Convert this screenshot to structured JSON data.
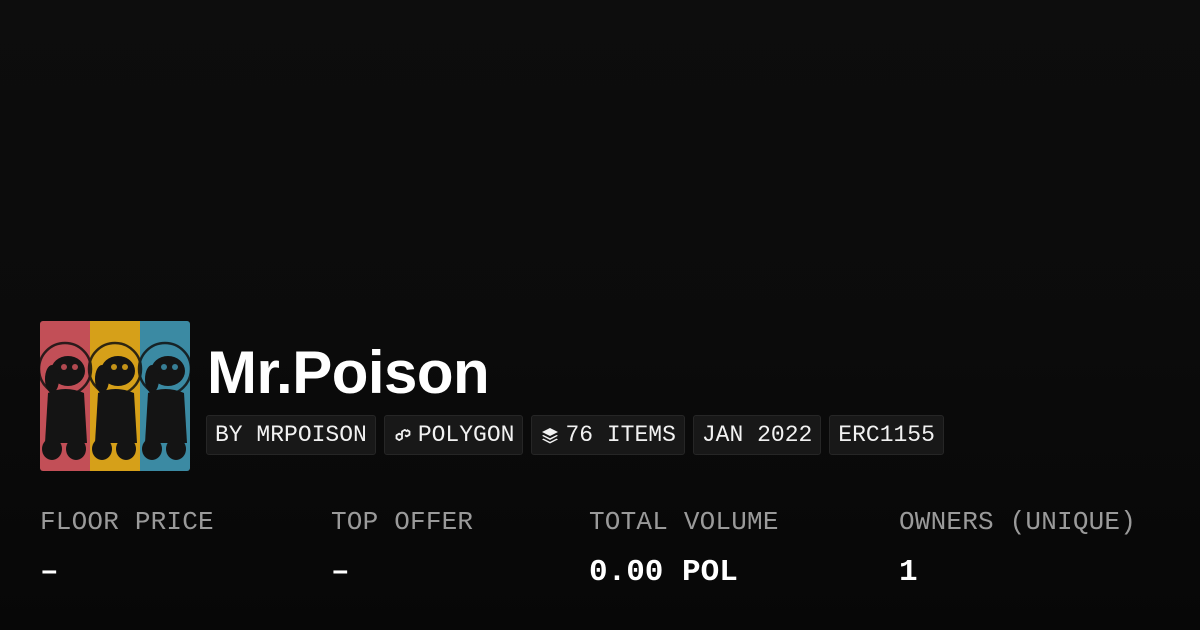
{
  "collection": {
    "name": "Mr.Poison",
    "avatar_alt": "Mr.Poison collection avatar"
  },
  "badges": {
    "creator": "BY MRPOISON",
    "chain": "POLYGON",
    "chain_icon": "polygon-icon",
    "items": "76 ITEMS",
    "items_icon": "layers-icon",
    "date": "JAN 2022",
    "standard": "ERC1155"
  },
  "stats": [
    {
      "label": "FLOOR PRICE",
      "value": "–"
    },
    {
      "label": "TOP OFFER",
      "value": "–"
    },
    {
      "label": "TOTAL VOLUME",
      "value": "0.00 POL"
    },
    {
      "label": "OWNERS (UNIQUE)",
      "value": "1"
    }
  ],
  "colors": {
    "background": "#0a0a0a",
    "badge_bg": "#181818",
    "label": "#9a9a9a",
    "avatar_panels": [
      "#c24f57",
      "#d6a019",
      "#3b8aa3"
    ]
  }
}
